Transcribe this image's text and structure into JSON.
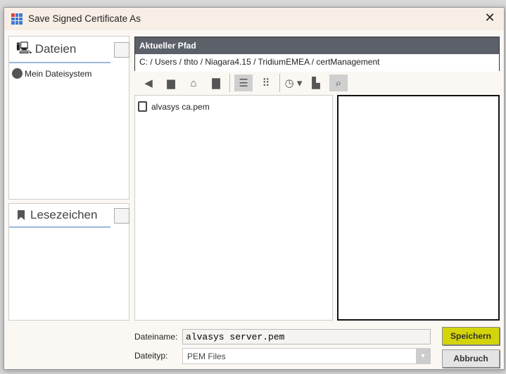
{
  "window": {
    "title": "Save Signed Certificate As",
    "close_label": "✕"
  },
  "left": {
    "files_tab": "Dateien",
    "files_items": [
      {
        "label": "Mein Dateisystem",
        "icon": "drive-icon"
      }
    ],
    "bookmarks_tab": "Lesezeichen"
  },
  "path": {
    "header": "Aktueller Pfad",
    "value": "C: / Users / thto / Niagara4.15 / TridiumEMEA / certManagement"
  },
  "toolbar": {
    "icons": [
      "back-icon",
      "folder-up-icon",
      "home-icon",
      "new-folder-icon",
      "list-view-icon",
      "grid-view-icon",
      "history-icon",
      "bookmark-add-icon",
      "preview-icon"
    ]
  },
  "files": [
    {
      "name": "alvasys ca.pem",
      "icon": "certificate-icon"
    }
  ],
  "form": {
    "filename_label": "Dateiname:",
    "filename_value": "alvasys server.pem",
    "filetype_label": "Dateityp:",
    "filetype_value": "PEM Files"
  },
  "buttons": {
    "save": "Speichern",
    "cancel": "Abbruch"
  },
  "colors": {
    "save_accent": "#d4d40a",
    "path_header": "#5c6069"
  }
}
